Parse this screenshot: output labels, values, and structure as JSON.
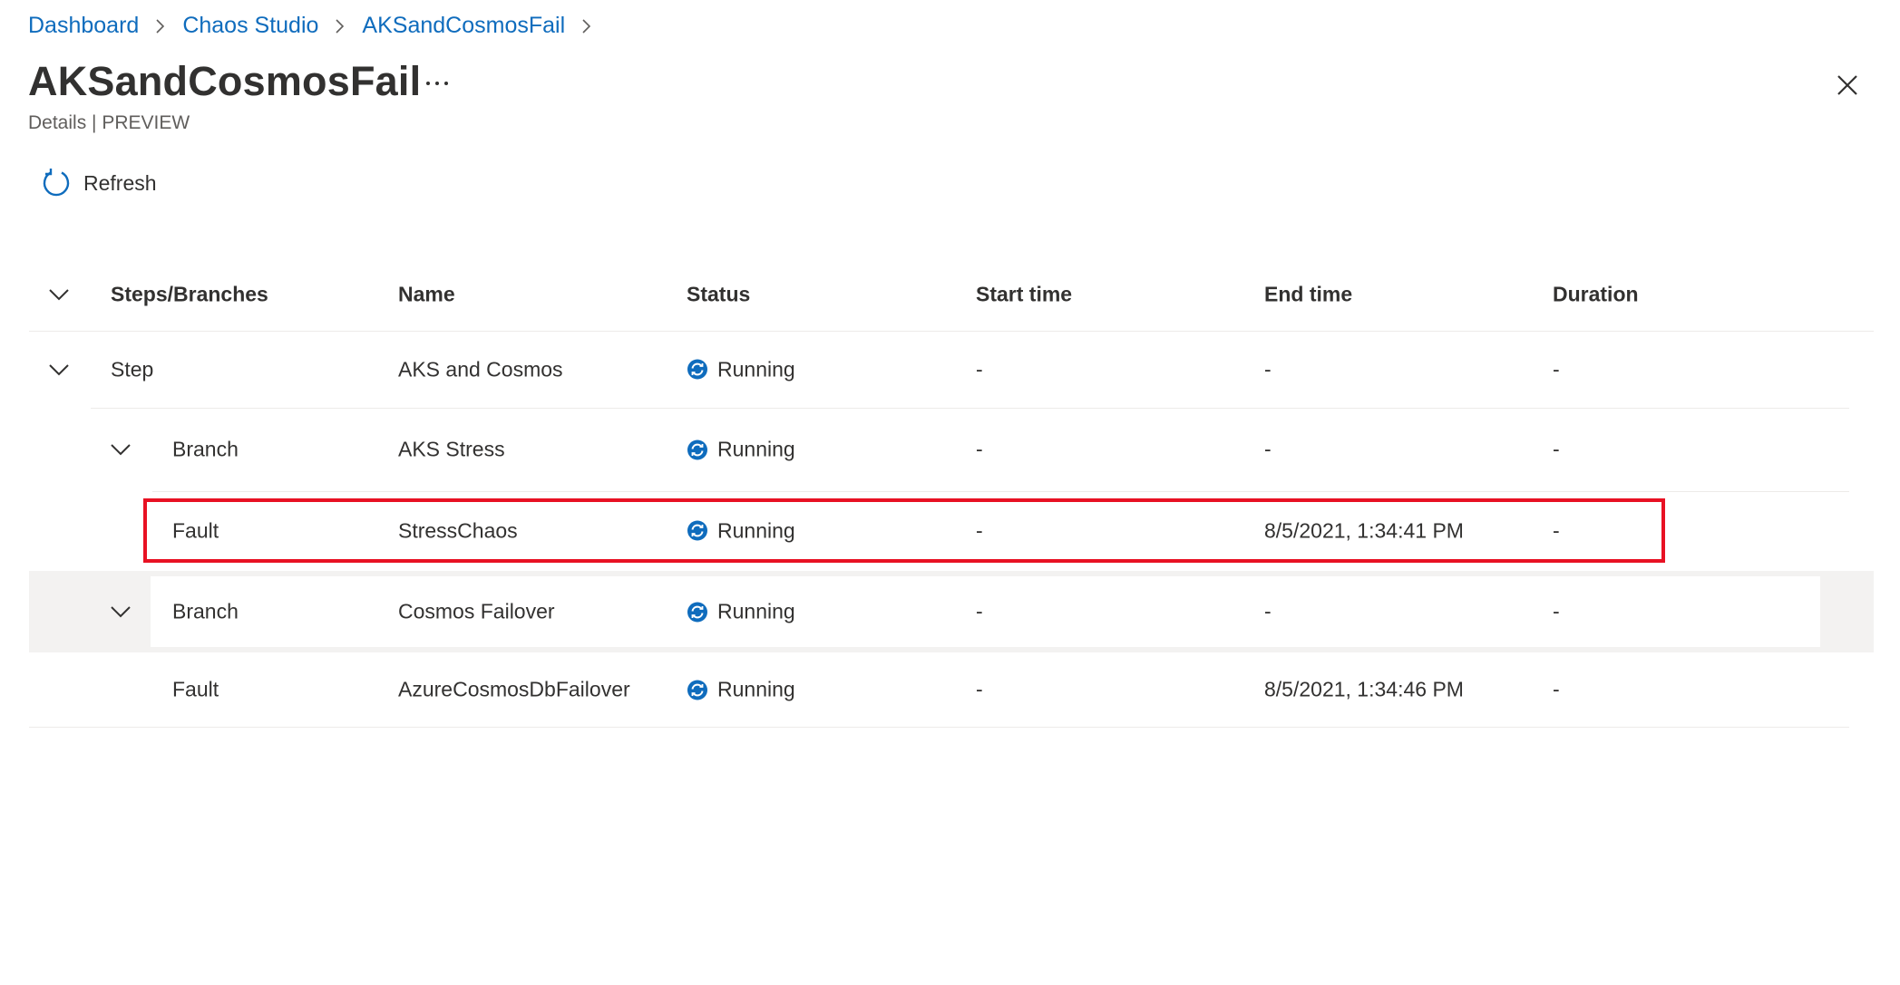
{
  "breadcrumb": {
    "items": [
      {
        "label": "Dashboard"
      },
      {
        "label": "Chaos Studio"
      },
      {
        "label": "AKSandCosmosFail"
      }
    ]
  },
  "page": {
    "title": "AKSandCosmosFail",
    "more_label": "...",
    "subtitle": "Details | PREVIEW"
  },
  "toolbar": {
    "refresh_label": "Refresh",
    "refresh_icon": "refresh-icon"
  },
  "table": {
    "columns": [
      "Steps/Branches",
      "Name",
      "Status",
      "Start time",
      "End time",
      "Duration"
    ],
    "rows": [
      {
        "type": "Step",
        "name": "AKS and Cosmos",
        "status": "Running",
        "start": "-",
        "end": "-",
        "duration": "-"
      },
      {
        "type": "Branch",
        "name": "AKS Stress",
        "status": "Running",
        "start": "-",
        "end": "-",
        "duration": "-"
      },
      {
        "type": "Fault",
        "name": "StressChaos",
        "status": "Running",
        "start": "-",
        "end": "8/5/2021, 1:34:41 PM",
        "duration": "-"
      },
      {
        "type": "Branch",
        "name": "Cosmos Failover",
        "status": "Running",
        "start": "-",
        "end": "-",
        "duration": "-"
      },
      {
        "type": "Fault",
        "name": "AzureCosmosDbFailover",
        "status": "Running",
        "start": "-",
        "end": "8/5/2021, 1:34:46 PM",
        "duration": "-"
      }
    ]
  },
  "colors": {
    "link": "#0f6cbd",
    "status_running": "#0f6cbd",
    "highlight_border": "#e81123",
    "row_hover": "#f3f2f1"
  }
}
